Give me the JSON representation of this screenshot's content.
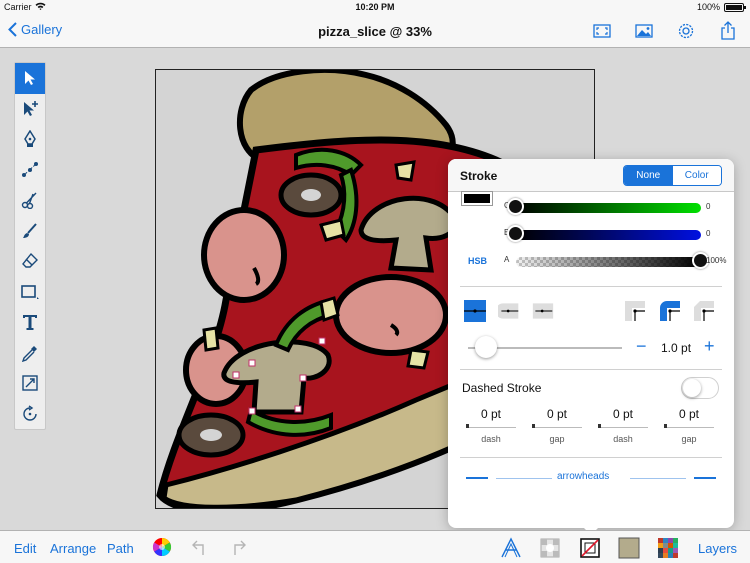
{
  "status": {
    "carrier": "Carrier",
    "time": "10:20 PM",
    "battery": "100%"
  },
  "nav": {
    "back_label": "Gallery",
    "title": "pizza_slice @ 33%"
  },
  "toolbox": {
    "tools": [
      "select-arrow",
      "node-select",
      "pen",
      "bezier-nodes",
      "scissors",
      "brush",
      "eraser",
      "rectangle-shape",
      "text-T",
      "eyedropper",
      "transform",
      "rotate"
    ]
  },
  "stroke_popover": {
    "title": "Stroke",
    "mode_none": "None",
    "mode_color": "Color",
    "channels": [
      {
        "label": "G",
        "value": "0",
        "level": 0
      },
      {
        "label": "B",
        "value": "0",
        "level": 0
      },
      {
        "label": "A",
        "value": "100%",
        "level": 1
      }
    ],
    "hsb_label": "HSB",
    "width_value": "1.0 pt",
    "minus_label": "−",
    "plus_label": "+",
    "dashed_label": "Dashed Stroke",
    "dashed_on": false,
    "dash_fields": [
      {
        "value": "0 pt",
        "label": "dash"
      },
      {
        "value": "0 pt",
        "label": "gap"
      },
      {
        "value": "0 pt",
        "label": "dash"
      },
      {
        "value": "0 pt",
        "label": "gap"
      }
    ],
    "arrowheads_label": "arrowheads"
  },
  "bottom": {
    "edit": "Edit",
    "arrange": "Arrange",
    "path": "Path",
    "layers": "Layers",
    "fill_swatch_color": "#b3ab8c"
  },
  "colors": {
    "accent": "#1a73d9",
    "sauce": "#a8141e",
    "crust": "#c7b98a",
    "cheese_edge": "#d9c99e",
    "pepperoni": "#d9938c",
    "mushroom": "#b3ab8c",
    "olive": "#5a4a3d",
    "pepper": "#4f9a2b",
    "onion": "#e6e2a5"
  }
}
